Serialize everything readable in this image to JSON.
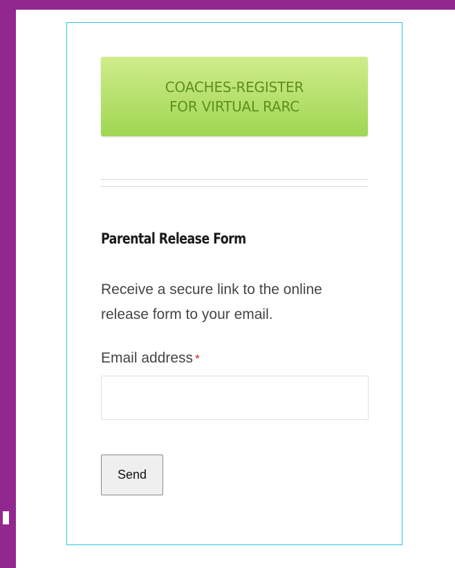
{
  "colors": {
    "frame_purple": "#92278f",
    "widget_border": "#29c4dd",
    "register_button_top": "#d0ec8c",
    "register_button_bottom": "#9fd652",
    "register_button_text": "#5c8f1c",
    "required_marker": "#cc1f1f"
  },
  "register_button": {
    "line1": "COACHES-REGISTER",
    "line2": "FOR VIRTUAL RARC"
  },
  "form": {
    "title": "Parental Release Form",
    "description": "Receive a secure link to the online release form to your email.",
    "email_label": "Email address",
    "required_marker": "*",
    "email_value": "",
    "send_label": "Send"
  }
}
